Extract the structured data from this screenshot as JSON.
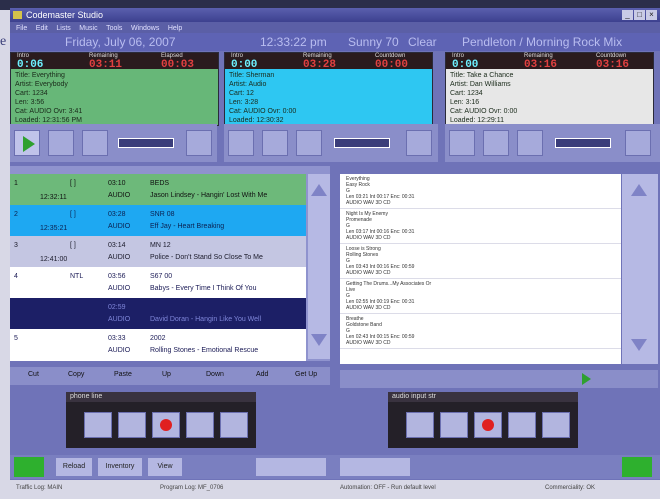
{
  "window": {
    "title": "Codemaster Studio",
    "menu": [
      "File",
      "Edit",
      "Lists",
      "Music",
      "Tools",
      "Windows",
      "Help"
    ]
  },
  "datebar": {
    "date": "Friday, July 06, 2007",
    "time": "12:33:22 pm",
    "temp": "Sunny 70",
    "weather": "Clear",
    "program": "Pendleton / Morning Rock Mix"
  },
  "decks": [
    {
      "labels": [
        "Intro",
        "Remaining",
        "Elapsed"
      ],
      "values": [
        "0:06",
        "03:11",
        "00:03"
      ],
      "lines": [
        "Title: Everything",
        "Artist: Everybody",
        "Cart: 1234",
        "Len: 3:56",
        "Cat: AUDIO   Ovr: 3:41",
        "Loaded: 12:31:56 PM"
      ],
      "color": "#67b778"
    },
    {
      "labels": [
        "Intro",
        "Remaining",
        "Countdown"
      ],
      "values": [
        "0:00",
        "03:28",
        "00:00"
      ],
      "lines": [
        "Title: Sherman",
        "Artist: Audio",
        "Cart: 12",
        "Len: 3:28",
        "Cat: AUDIO  Ovr: 0:00",
        "Loaded: 12:30:32"
      ],
      "color": "#2ec7f2"
    },
    {
      "labels": [
        "Intro",
        "Remaining",
        "Countdown"
      ],
      "values": [
        "0:00",
        "03:16",
        "03:16"
      ],
      "lines": [
        "Title: Take a Chance",
        "Artist: Dan Williams",
        "Cart: 1234",
        "Len: 3:16",
        "Cat: AUDIO  Ovr: 0:00",
        "Loaded: 12:29:11"
      ],
      "color": "#e7e7e7"
    }
  ],
  "playlist": [
    {
      "n": "1",
      "time": "12:32:11",
      "type": "[ ]",
      "len": "03:10",
      "code": "BEDS",
      "cat": "AUDIO",
      "title": "Jason Lindsey - Hangin' Lost With Me",
      "bg": "#6db97a",
      "fg": "#111"
    },
    {
      "n": "2",
      "time": "12:35:21",
      "type": "[ ]",
      "len": "03:28",
      "code": "SNR 08",
      "cat": "AUDIO",
      "title": "Eff Jay - Heart Breaking",
      "bg": "#1ea8f2",
      "fg": "#0b2050"
    },
    {
      "n": "3",
      "time": "12:41:00",
      "type": "[ ]",
      "len": "03:14",
      "code": "MN 12",
      "cat": "AUDIO",
      "title": "Police - Don't Stand So Close To Me",
      "bg": "#c4c6e2",
      "fg": "#1a1a2a"
    },
    {
      "n": "4",
      "time": "",
      "type": "NTL",
      "len": "03:56",
      "code": "S67 00",
      "cat": "AUDIO",
      "title": "Babys - Every Time I Think Of You",
      "bg": "#ffffff",
      "fg": "#1a1a55"
    },
    {
      "n": "",
      "time": "",
      "type": "",
      "len": "02:59",
      "code": "",
      "cat": "AUDIO",
      "title": "David Doran - Hangin Like You Well",
      "bg": "#1c1f66",
      "fg": "#7f86d9"
    },
    {
      "n": "5",
      "time": "",
      "type": "",
      "len": "03:33",
      "code": "2002",
      "cat": "AUDIO",
      "title": "Rolling Stones - Emotional Rescue",
      "bg": "#ffffff",
      "fg": "#1a1a55"
    }
  ],
  "listbuttons": [
    "Cut",
    "Copy",
    "Paste",
    "Up",
    "Down",
    "Add",
    "Get Up"
  ],
  "library": [
    {
      "title": "Everything",
      "artist": "Easy Rock",
      "cat": "G",
      "len": "Len 03:21  Int 00:17  Enc: 00:31",
      "type": "AUDIO  WAV  3D  CD"
    },
    {
      "title": "Night Is My Enemy",
      "artist": "Promenade",
      "cat": "G",
      "len": "Len 03:17  Int 00:16  Enc: 00:31",
      "type": "AUDIO  WAV  3D  CD"
    },
    {
      "title": "Loose is Strong",
      "artist": "Rolling Stones",
      "cat": "G",
      "len": "Len 03:43  Int 00:16  Enc: 00:59",
      "type": "AUDIO  WAV  3D  CD"
    },
    {
      "title": "Getting The Drums...My Associates Or",
      "artist": "Live",
      "cat": "G",
      "len": "Len 02:55  Int 00:19  Enc: 00:31",
      "type": "AUDIO  WAV  3D  CD"
    },
    {
      "title": "Breathe",
      "artist": "Goldstone Band",
      "cat": "G",
      "len": "Len 02:43  Int 00:15  Enc: 00:59",
      "type": "AUDIO  WAV  3D  CD"
    }
  ],
  "recorders": [
    {
      "label": "phone line"
    },
    {
      "label": "audio input str"
    }
  ],
  "bottom": {
    "btn1": "Reload",
    "btn2": "Inventory",
    "btn3": "View"
  },
  "status": [
    "Traffic Log: MAIN",
    "Program Log: MF_0706",
    "Automation: OFF - Run default level",
    "Commerciality: OK"
  ]
}
